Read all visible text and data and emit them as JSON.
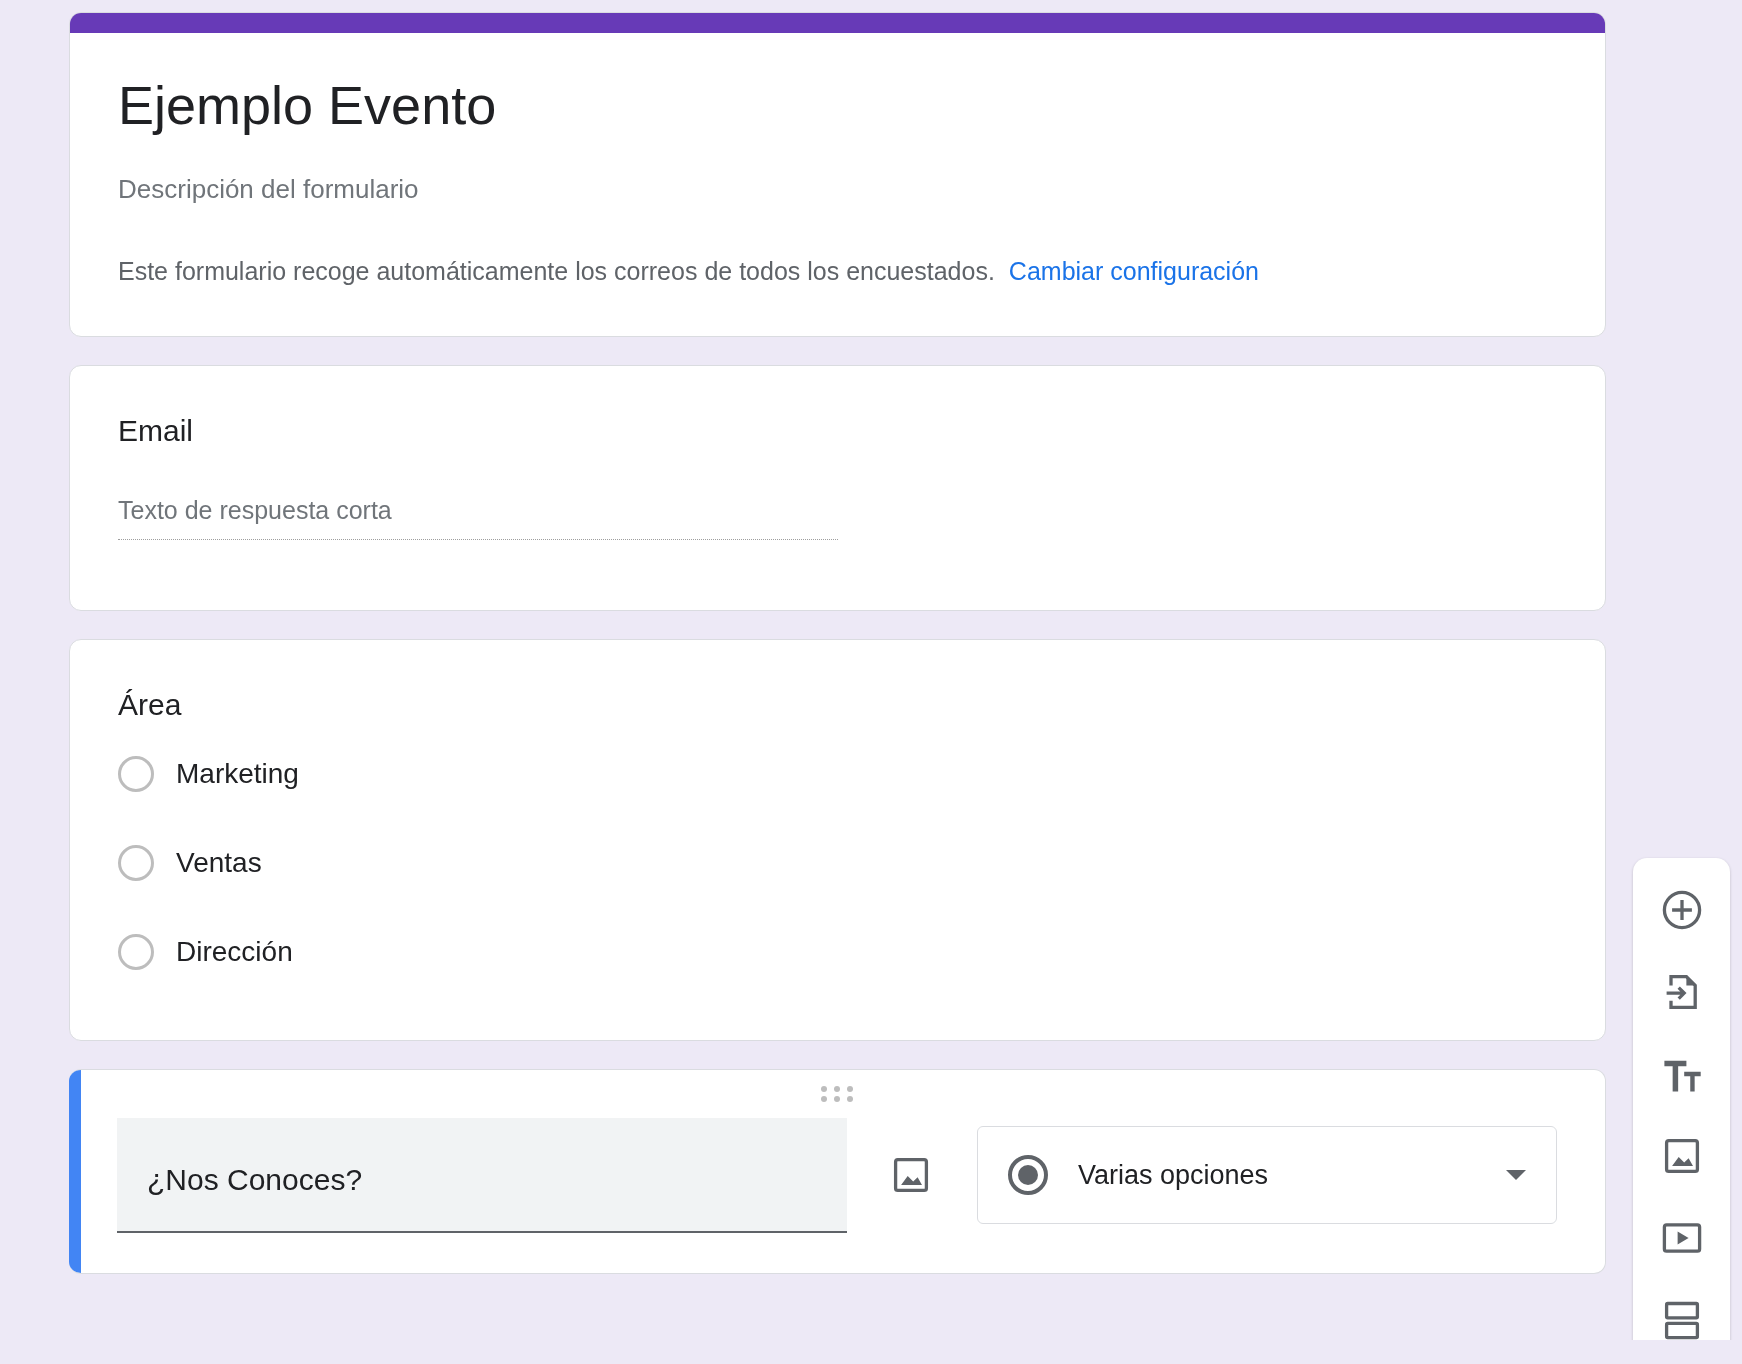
{
  "form": {
    "title": "Ejemplo Evento",
    "description": "Descripción del formulario",
    "email_notice": "Este formulario recoge automáticamente los correos de todos los encuestados.",
    "settings_link": "Cambiar configuración"
  },
  "questions": [
    {
      "kind": "short_answer",
      "active": false,
      "title": "Email",
      "placeholder": "Texto de respuesta corta"
    },
    {
      "kind": "multiple_choice",
      "active": false,
      "title": "Área",
      "options": [
        {
          "label": "Marketing",
          "selected": false
        },
        {
          "label": "Ventas",
          "selected": false
        },
        {
          "label": "Dirección",
          "selected": false
        }
      ]
    },
    {
      "kind": "editor",
      "active": true,
      "title": "¿Nos Conoces?",
      "type_label": "Varias opciones"
    }
  ]
}
